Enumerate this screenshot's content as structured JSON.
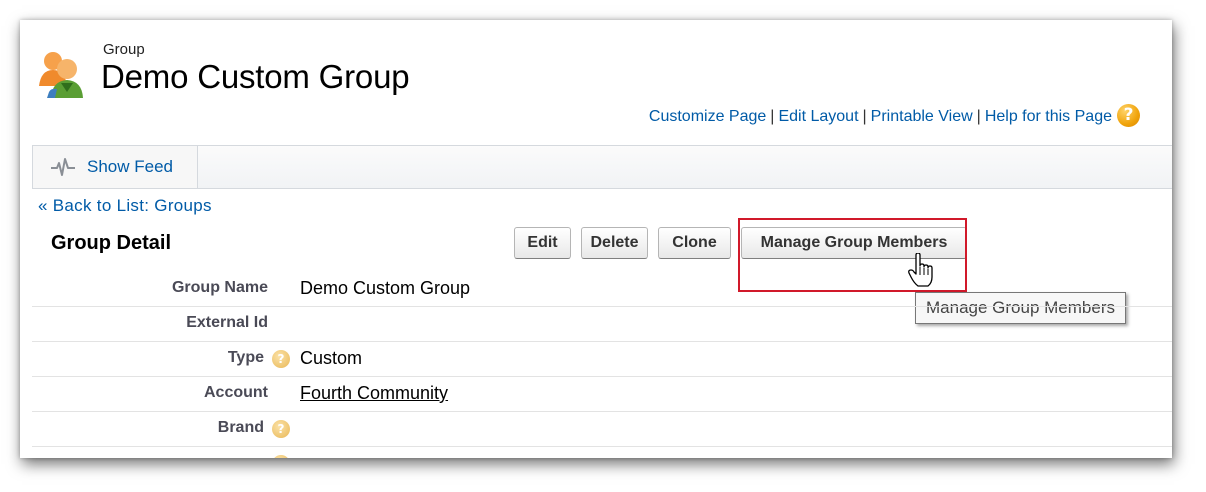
{
  "header": {
    "object_type": "Group",
    "title": "Demo Custom Group",
    "help_icon_glyph": "?"
  },
  "links": {
    "customize": "Customize Page",
    "edit_layout": "Edit Layout",
    "printable": "Printable View",
    "help": "Help for this Page",
    "separator": "|"
  },
  "feed": {
    "label": "Show Feed",
    "icon": "pulse-icon"
  },
  "back_link": "« Back to List: Groups",
  "section": {
    "title": "Group Detail"
  },
  "buttons": {
    "edit": "Edit",
    "delete": "Delete",
    "clone": "Clone",
    "manage": "Manage Group Members"
  },
  "tooltip": "Manage Group Members",
  "details": {
    "rows": [
      {
        "label": "Group Name",
        "value": "Demo Custom Group"
      },
      {
        "label": "External Id",
        "value": ""
      },
      {
        "label": "Type",
        "value": "Custom"
      },
      {
        "label": "Account",
        "value": "Fourth Community"
      },
      {
        "label": "Brand",
        "value": ""
      }
    ]
  },
  "colors": {
    "link": "#015ba7",
    "highlight": "#d1192a",
    "help_badge": "#f0a30a"
  }
}
